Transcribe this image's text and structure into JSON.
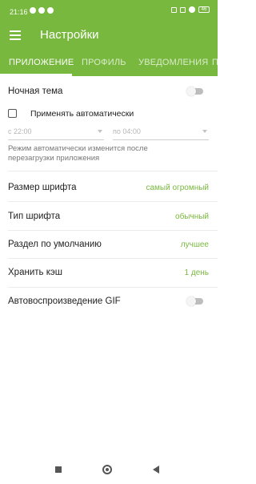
{
  "status": {
    "time": "21:16",
    "battery": "46"
  },
  "appbar": {
    "title": "Настройки"
  },
  "tabs": [
    {
      "label": "ПРИЛОЖЕНИЕ",
      "active": true
    },
    {
      "label": "ПРОФИЛЬ",
      "active": false
    },
    {
      "label": "УВЕДОМЛЕНИЯ",
      "active": false
    },
    {
      "label": "П",
      "active": false
    }
  ],
  "settings": {
    "night_theme": {
      "label": "Ночная тема",
      "enabled": false
    },
    "auto_apply": {
      "label": "Применять автоматически",
      "checked": false
    },
    "from_time": "с 22:00",
    "to_time": "по 04:00",
    "auto_hint": "Режим автоматически изменится после перезагрузки приложения",
    "font_size": {
      "label": "Размер шрифта",
      "value": "самый огромный"
    },
    "font_type": {
      "label": "Тип шрифта",
      "value": "обычный"
    },
    "default_section": {
      "label": "Раздел по умолчанию",
      "value": "лучшее"
    },
    "cache": {
      "label": "Хранить кэш",
      "value": "1 день"
    },
    "gif_autoplay": {
      "label": "Автовоспроизведение GIF",
      "enabled": false
    }
  },
  "colors": {
    "accent": "#79b83f",
    "toggle_off": "#bdbdbd"
  }
}
